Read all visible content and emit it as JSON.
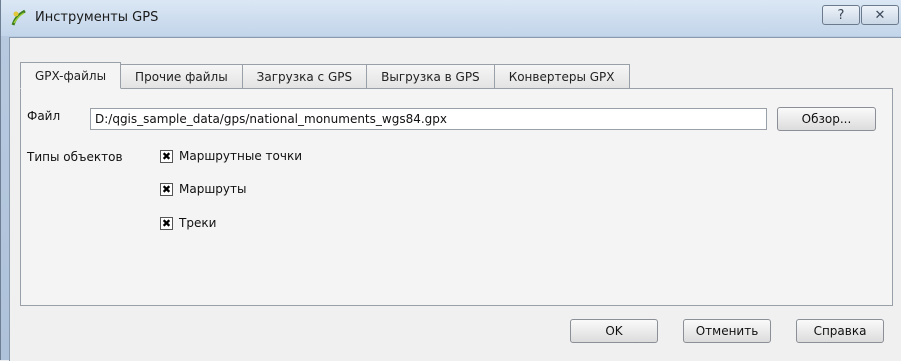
{
  "window": {
    "title": "Инструменты GPS",
    "help_glyph": "?",
    "close_glyph": "✕"
  },
  "tabs": [
    {
      "label": "GPX-файлы",
      "active": true
    },
    {
      "label": "Прочие файлы",
      "active": false
    },
    {
      "label": "Загрузка с GPS",
      "active": false
    },
    {
      "label": "Выгрузка в GPS",
      "active": false
    },
    {
      "label": "Конвертеры GPX",
      "active": false
    }
  ],
  "file": {
    "label": "Файл",
    "value": "D:/qgis_sample_data/gps/national_monuments_wgs84.gpx",
    "browse_label": "Обзор..."
  },
  "object_types": {
    "label": "Типы объектов",
    "items": [
      {
        "label": "Маршрутные точки",
        "checked": true
      },
      {
        "label": "Маршруты",
        "checked": true
      },
      {
        "label": "Треки",
        "checked": true
      }
    ]
  },
  "buttons": {
    "ok": "OK",
    "cancel": "Отменить",
    "help": "Справка"
  },
  "icons": {
    "app": "qgis-gps-icon",
    "check_glyph": "✖"
  }
}
